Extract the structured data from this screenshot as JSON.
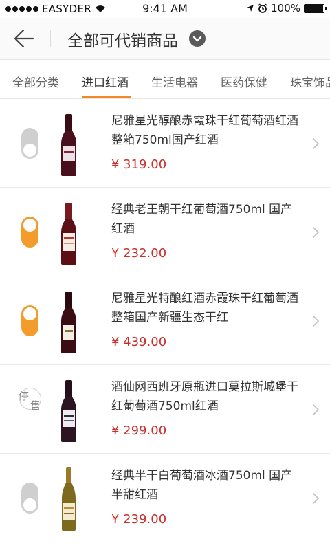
{
  "status_bar": {
    "carrier": "EASYDER",
    "time": "9:41 AM",
    "battery": "100%",
    "battery_level": 1.0
  },
  "header": {
    "title": "全部可代销商品"
  },
  "tabs": [
    {
      "label": "全部分类",
      "active": false
    },
    {
      "label": "进口红酒",
      "active": true
    },
    {
      "label": "生活电器",
      "active": false
    },
    {
      "label": "医药保健",
      "active": false
    },
    {
      "label": "珠宝饰品",
      "active": false
    }
  ],
  "products": [
    {
      "title": "尼雅星光醇酿赤霞珠干红葡萄酒红酒整箱750ml国产红酒",
      "price": "¥ 319.00",
      "status": "off",
      "bottle": "wine",
      "label_color": "#e9e1e6"
    },
    {
      "title": "经典老王朝干红葡萄酒750ml 国产红酒",
      "price": "¥ 232.00",
      "status": "on",
      "bottle": "wine",
      "label_color": "#f3ece7"
    },
    {
      "title": "尼雅星光特酿红酒赤霞珠干红葡萄酒整箱国产新疆生态干红",
      "price": "¥ 439.00",
      "status": "on",
      "bottle": "wine",
      "label_color": "#f2eee4"
    },
    {
      "title": "酒仙网西班牙原瓶进口莫拉斯城堡干红葡萄酒750ml红酒",
      "price": "¥ 299.00",
      "status": "stopped",
      "stopped_label": "停售",
      "bottle": "wine",
      "label_color": "#ecebef"
    },
    {
      "title": "经典半干白葡萄酒冰酒750ml 国产半甜红酒",
      "price": "¥ 239.00",
      "status": "off",
      "bottle": "white",
      "label_color": "#f3ead2"
    }
  ],
  "icons": {
    "back": "back-arrow-icon",
    "title_dropdown": "chevron-down-icon",
    "row_arrow": "chevron-right-icon"
  },
  "colors": {
    "accent": "#f08a24",
    "toggle_on": "#f39c2b",
    "toggle_off": "#cfcfcf",
    "price": "#c9302c"
  }
}
